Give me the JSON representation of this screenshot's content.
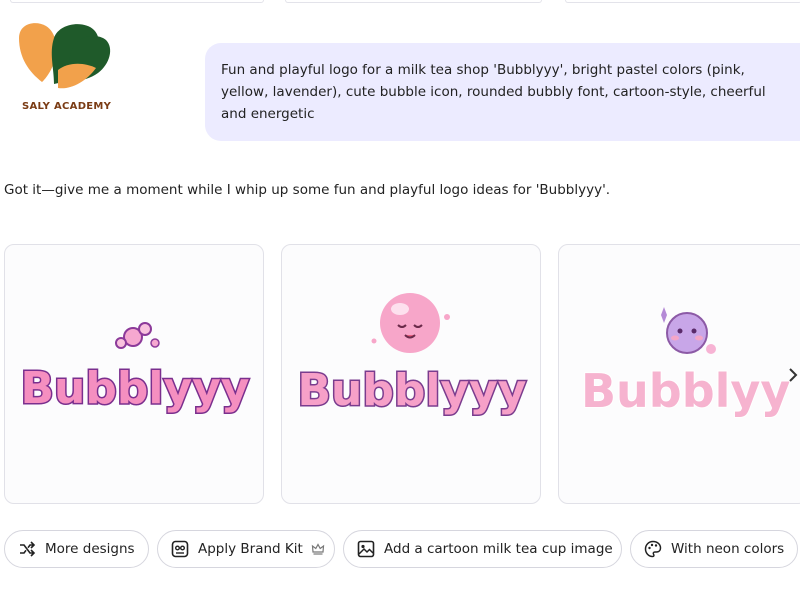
{
  "brand": {
    "name": "SALY ACADEMY"
  },
  "prompt": {
    "text": "Fun and playful logo for a milk tea shop 'Bubblyyy', bright pastel colors (pink, yellow, lavender), cute bubble icon, rounded bubbly font, cartoon-style, cheerful and energetic"
  },
  "reply": {
    "text": "Got it—give me a moment while I whip up some fun and playful logo ideas for 'Bubblyyy'."
  },
  "designs": [
    {
      "wordmark": "Bubblyyy",
      "style": "pink-purple-outline"
    },
    {
      "wordmark": "Bubblyyy",
      "style": "pink-bubble-face"
    },
    {
      "wordmark": "Bubblyy",
      "style": "pastel-rainbow"
    }
  ],
  "actions": [
    {
      "label": "More designs",
      "icon": "shuffle-icon"
    },
    {
      "label": "Apply Brand Kit",
      "icon": "brand-kit-icon",
      "badge_icon": "crown-icon"
    },
    {
      "label": "Add a cartoon milk tea cup image",
      "icon": "image-icon"
    },
    {
      "label": "With neon colors",
      "icon": "palette-icon"
    }
  ],
  "colors": {
    "prompt_bg": "#ecebff",
    "logo_orange": "#f2a14b",
    "logo_green": "#1f5a2a",
    "pink": "#f58fc0",
    "purple": "#7a3c8e"
  }
}
